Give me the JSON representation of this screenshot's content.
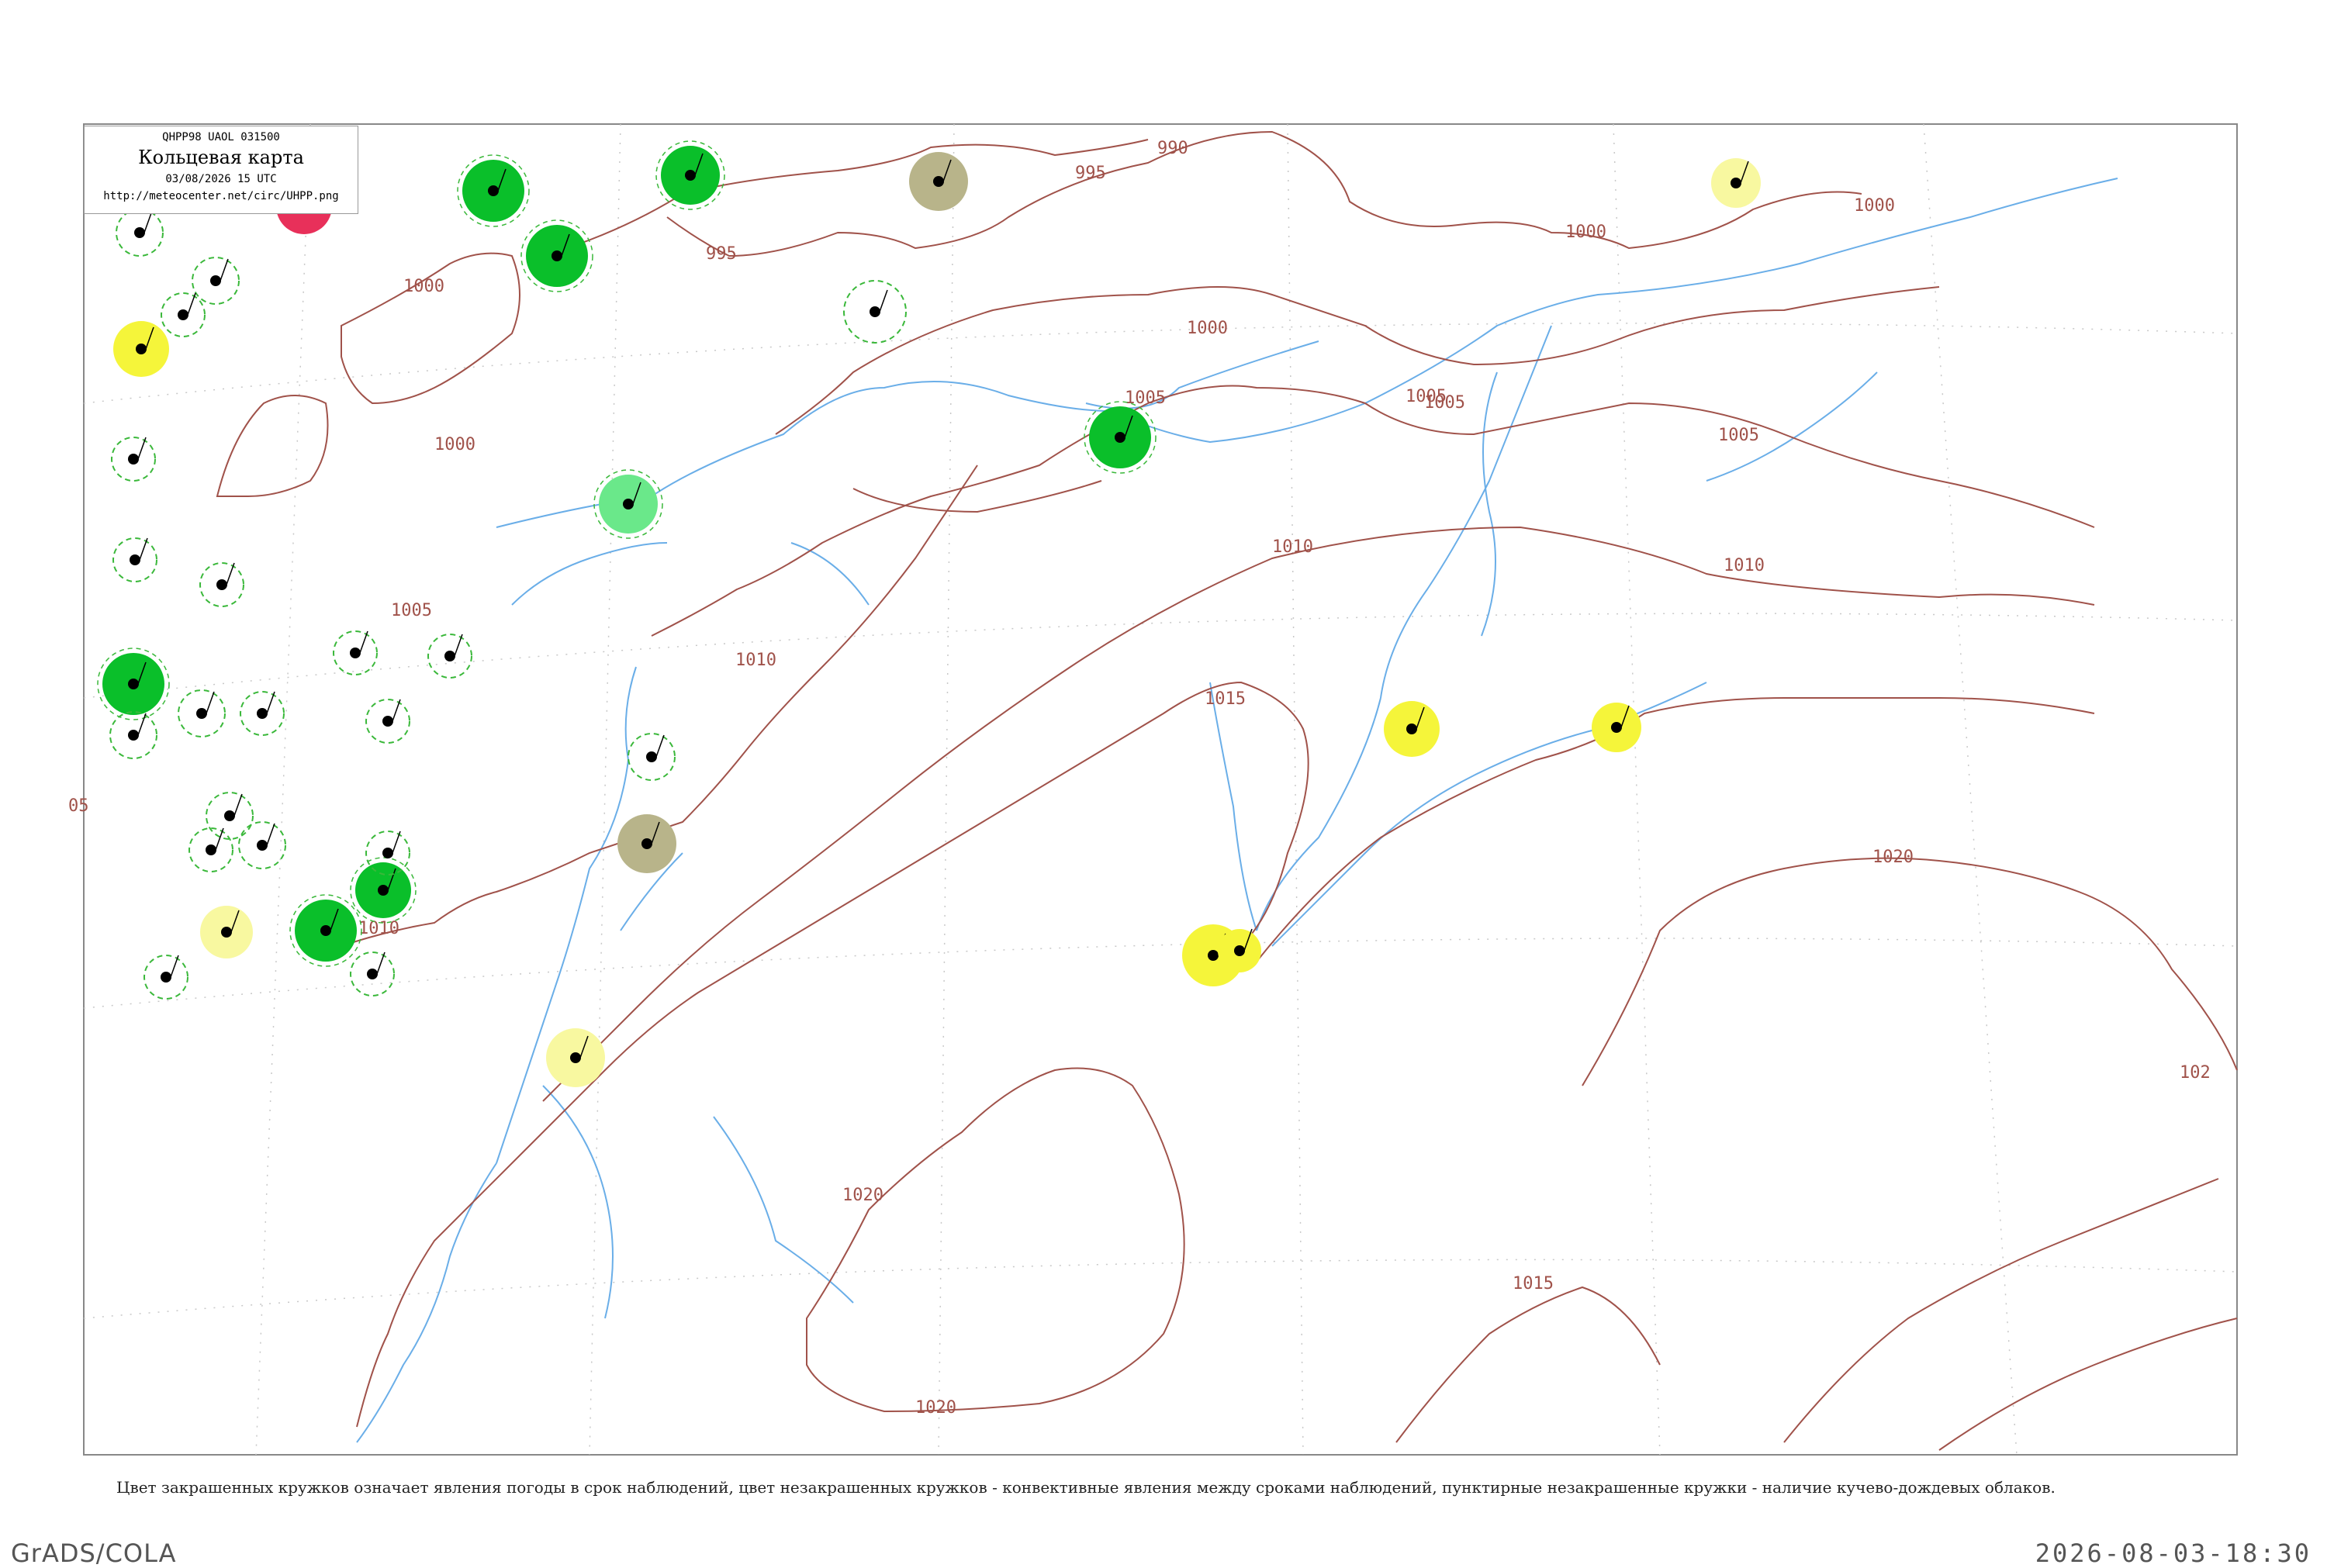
{
  "header": {
    "code_line": "QHPP98  UAOL  031500",
    "title": "Кольцевая карта",
    "datetime": "03/08/2026 15 UTC",
    "url": "http://meteocenter.net/circ/UHPP.png"
  },
  "caption": "Цвет закрашенных кружков означает явления погоды в срок наблюдений, цвет незакрашенных кружков - конвективные явления между сроками наблюдений, пунктирные незакрашенные кружки - наличие кучево-дождевых облаков.",
  "footer": {
    "software": "GrADS/COLA",
    "timestamp": "2026-08-03-18:30"
  },
  "colors": {
    "isobar": "#a0524a",
    "river": "#6aaee8",
    "frame": "#888888",
    "green_dark": "#0abf2a",
    "green_light": "#6ae88a",
    "yellow": "#f5f53a",
    "yellow_light": "#f8f8a0",
    "olive": "#b8b48a",
    "red": "#e8305a",
    "dashed_ring": "#3ab83a"
  },
  "isobar_labels": [
    "990",
    "995",
    "1000",
    "1005",
    "1010",
    "1015",
    "1020",
    "102"
  ],
  "isobar_label_list": [
    {
      "text": "990"
    },
    {
      "text": "995"
    },
    {
      "text": "995"
    },
    {
      "text": "1000"
    },
    {
      "text": "1000"
    },
    {
      "text": "1000"
    },
    {
      "text": "1000"
    },
    {
      "text": "1000"
    },
    {
      "text": "1005"
    },
    {
      "text": "1005"
    },
    {
      "text": "1005"
    },
    {
      "text": "1005"
    },
    {
      "text": "1005"
    },
    {
      "text": "1010"
    },
    {
      "text": "1010"
    },
    {
      "text": "1010"
    },
    {
      "text": "1010"
    },
    {
      "text": "1015"
    },
    {
      "text": "1015"
    },
    {
      "text": "1020"
    },
    {
      "text": "1020"
    },
    {
      "text": "1020"
    },
    {
      "text": "102"
    },
    {
      "text": "05"
    }
  ],
  "station_symbols": [
    {
      "kind": "red"
    },
    {
      "kind": "green_dark"
    },
    {
      "kind": "green_dark"
    },
    {
      "kind": "green_dark"
    },
    {
      "kind": "green_dark"
    },
    {
      "kind": "green_dark"
    },
    {
      "kind": "green_dark"
    },
    {
      "kind": "green_dark"
    },
    {
      "kind": "green_light"
    },
    {
      "kind": "yellow"
    },
    {
      "kind": "yellow"
    },
    {
      "kind": "yellow"
    },
    {
      "kind": "yellow"
    },
    {
      "kind": "yellow"
    },
    {
      "kind": "yellow_light"
    },
    {
      "kind": "yellow_light"
    },
    {
      "kind": "yellow_light"
    },
    {
      "kind": "olive"
    },
    {
      "kind": "olive"
    },
    {
      "kind": "ring"
    },
    {
      "kind": "ring"
    },
    {
      "kind": "ring"
    },
    {
      "kind": "ring"
    },
    {
      "kind": "ring"
    },
    {
      "kind": "ring"
    },
    {
      "kind": "ring"
    },
    {
      "kind": "ring"
    },
    {
      "kind": "ring"
    },
    {
      "kind": "ring"
    },
    {
      "kind": "ring"
    },
    {
      "kind": "ring"
    },
    {
      "kind": "ring"
    },
    {
      "kind": "ring"
    },
    {
      "kind": "ring"
    },
    {
      "kind": "ring"
    },
    {
      "kind": "ring"
    },
    {
      "kind": "ring"
    },
    {
      "kind": "ring"
    },
    {
      "kind": "ring"
    }
  ]
}
